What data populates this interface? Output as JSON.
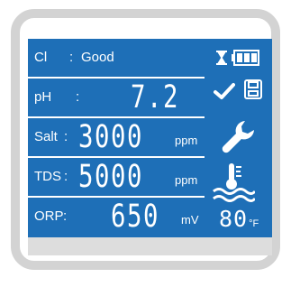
{
  "rows": {
    "cl": {
      "label": "Cl",
      "colon": ":",
      "status": "Good"
    },
    "ph": {
      "label": "pH",
      "colon": ":",
      "value": "7.2"
    },
    "salt": {
      "label": "Salt",
      "colon": ":",
      "value": "3000",
      "unit": "ppm"
    },
    "tds": {
      "label": "TDS",
      "colon": ":",
      "value": "5000",
      "unit": "ppm"
    },
    "orp": {
      "label": "ORP",
      "colon": ":",
      "value": "650",
      "unit": "mV"
    }
  },
  "status_icons": {
    "timer_icon": "hourglass-icon",
    "battery_icon": "battery-icon",
    "battery_level": 1.0,
    "check_icon": "check-icon",
    "save_icon": "save-icon",
    "settings_icon": "wrench-icon",
    "water_temp_icon": "water-temperature-icon"
  },
  "temperature": {
    "value": "80",
    "unit": "°F"
  },
  "colors": {
    "screen": "#1e6fb7",
    "text": "#ffffff",
    "bezel": "#d3d3d3",
    "lower_panel": "#dddddd"
  }
}
